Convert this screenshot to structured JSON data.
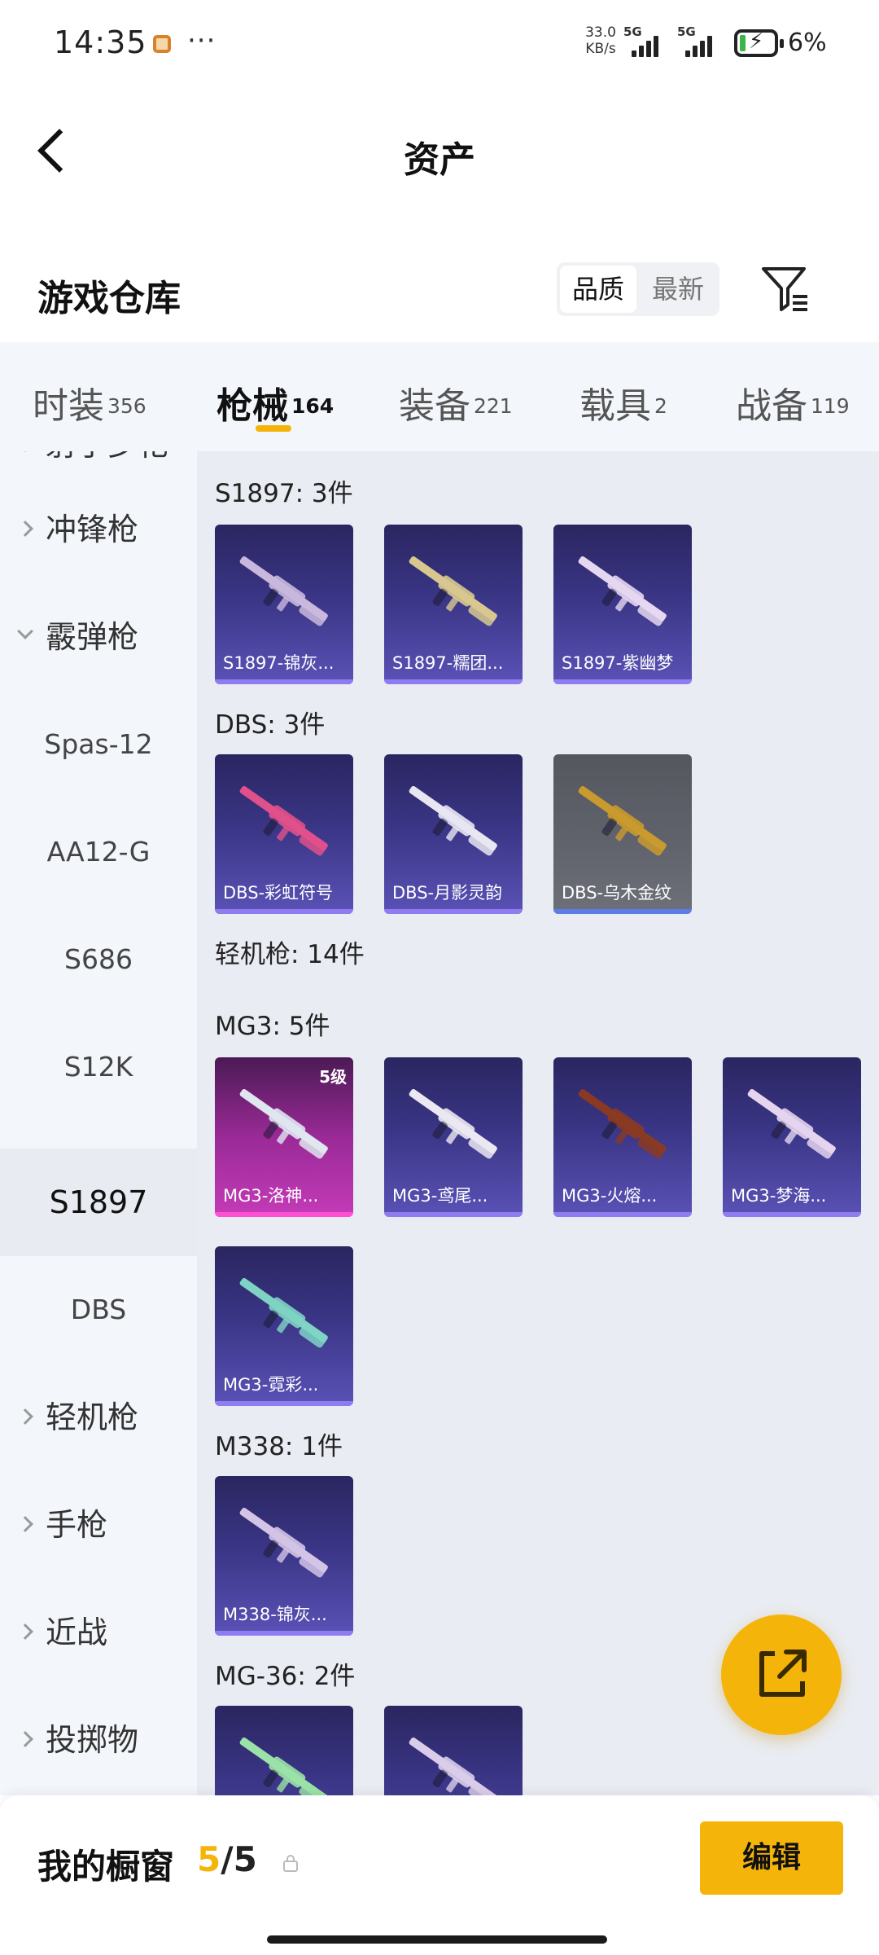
{
  "status_bar": {
    "time": "14:35",
    "more": "···",
    "net_speed_value": "33.0",
    "net_speed_unit": "KB/s",
    "sim1": "5G",
    "sim2": "5G",
    "battery_percent": "6%",
    "battery_level": 0.06,
    "charging": true
  },
  "header": {
    "title": "资产",
    "back_icon": "chevron-left-icon"
  },
  "warehouse": {
    "title": "游戏仓库",
    "sort_options": [
      "品质",
      "最新"
    ],
    "sort_selected": "品质",
    "filter_icon": "filter-icon"
  },
  "tabs": [
    {
      "label": "时装",
      "count": "356"
    },
    {
      "label": "枪械",
      "count": "164",
      "active": true
    },
    {
      "label": "装备",
      "count": "221"
    },
    {
      "label": "载具",
      "count": "2"
    },
    {
      "label": "战备",
      "count": "119"
    }
  ],
  "sidebar": [
    {
      "label": "射手步枪",
      "type": "category",
      "state": "collapsed"
    },
    {
      "label": "冲锋枪",
      "type": "category",
      "state": "collapsed"
    },
    {
      "label": "霰弹枪",
      "type": "category",
      "state": "expanded"
    },
    {
      "label": "Spas-12",
      "type": "sub"
    },
    {
      "label": "AA12-G",
      "type": "sub"
    },
    {
      "label": "S686",
      "type": "sub"
    },
    {
      "label": "S12K",
      "type": "sub"
    },
    {
      "label": "S1897",
      "type": "sub",
      "selected": true
    },
    {
      "label": "DBS",
      "type": "sub"
    },
    {
      "label": "轻机枪",
      "type": "category",
      "state": "collapsed"
    },
    {
      "label": "手枪",
      "type": "category",
      "state": "collapsed"
    },
    {
      "label": "近战",
      "type": "category",
      "state": "collapsed"
    },
    {
      "label": "投掷物",
      "type": "category",
      "state": "collapsed"
    }
  ],
  "groups": [
    {
      "title": "S1897: 3件",
      "items": [
        {
          "name": "S1897-锦灰...",
          "rarity": "purple",
          "color": "#c9b8dd"
        },
        {
          "name": "S1897-糯团...",
          "rarity": "purple",
          "color": "#d8c890"
        },
        {
          "name": "S1897-紫幽梦",
          "rarity": "purple",
          "color": "#e6d7f0"
        }
      ]
    },
    {
      "title": "DBS: 3件",
      "items": [
        {
          "name": "DBS-彩虹符号",
          "rarity": "purple",
          "color": "#e0508a"
        },
        {
          "name": "DBS-月影灵韵",
          "rarity": "purple",
          "color": "#e8e6f2"
        },
        {
          "name": "DBS-乌木金纹",
          "rarity": "gray",
          "color": "#c99a2e"
        }
      ]
    },
    {
      "title": "轻机枪: 14件",
      "items": []
    },
    {
      "title": "MG3: 5件",
      "items": [
        {
          "name": "MG3-洛神...",
          "rarity": "pink",
          "level": "5级",
          "color": "#dfe6ef"
        },
        {
          "name": "MG3-鸢尾...",
          "rarity": "purple",
          "color": "#ece8f2"
        },
        {
          "name": "MG3-火熔...",
          "rarity": "purple",
          "color": "#8a3a22"
        },
        {
          "name": "MG3-梦海...",
          "rarity": "purple",
          "color": "#e4d4ee"
        },
        {
          "name": "MG3-霓彩...",
          "rarity": "purple",
          "color": "#7fd3c4"
        }
      ]
    },
    {
      "title": "M338: 1件",
      "items": [
        {
          "name": "M338-锦灰...",
          "rarity": "purple",
          "color": "#d3c4e6"
        }
      ]
    },
    {
      "title": "MG-36: 2件",
      "items": [
        {
          "name": "",
          "rarity": "purple",
          "color": "#9be2a8"
        },
        {
          "name": "",
          "rarity": "purple",
          "color": "#d9cdea"
        }
      ]
    }
  ],
  "fab": {
    "icon": "share-icon"
  },
  "bottom_bar": {
    "label": "我的橱窗",
    "current": "5",
    "separator": "/",
    "total": "5",
    "lock_icon": "lock-icon",
    "edit_label": "编辑"
  },
  "colors": {
    "accent": "#f5b40a",
    "card_purple": "#3a3585",
    "card_pink": "#c43bb8",
    "card_gray": "#62646d"
  }
}
